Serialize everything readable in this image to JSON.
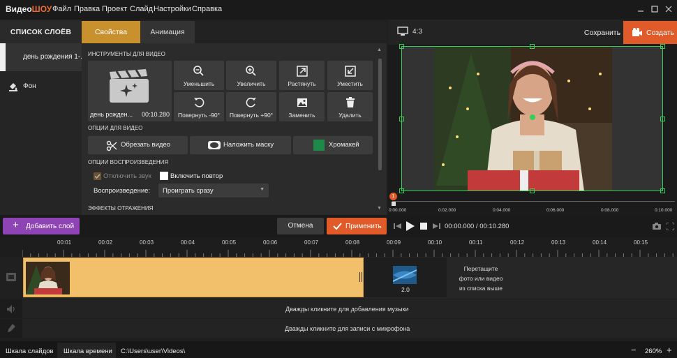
{
  "app": {
    "logo_part1": "Видео",
    "logo_part2": "ШОУ"
  },
  "menu": [
    "Файл",
    "Правка",
    "Проект",
    "Слайд",
    "Настройки",
    "Справка"
  ],
  "left": {
    "header": "СПИСОК СЛОЁВ",
    "layers": [
      {
        "label": "день рождения 1-..."
      },
      {
        "label": "Фон"
      }
    ]
  },
  "tabs": {
    "properties": "Свойства",
    "animation": "Анимация"
  },
  "props": {
    "section_tools": "ИНСТРУМЕНТЫ ДЛЯ ВИДЕО",
    "clip_name": "день рожден...",
    "clip_duration": "00:10.280",
    "tools": [
      {
        "label": "Уменьшить",
        "icon": "zoom-out-icon"
      },
      {
        "label": "Увеличить",
        "icon": "zoom-in-icon"
      },
      {
        "label": "Растянуть",
        "icon": "stretch-icon"
      },
      {
        "label": "Уместить",
        "icon": "fit-icon"
      },
      {
        "label": "Повернуть -90°",
        "icon": "rotate-left-icon"
      },
      {
        "label": "Повернуть +90°",
        "icon": "rotate-right-icon"
      },
      {
        "label": "Заменить",
        "icon": "replace-icon"
      },
      {
        "label": "Удалить",
        "icon": "delete-icon"
      }
    ],
    "section_video_options": "ОПЦИИ ДЛЯ ВИДЕО",
    "btn_trim": "Обрезать видео",
    "btn_mask": "Наложить маску",
    "btn_chroma": "Хромакей",
    "chroma_color": "#1e8a4a",
    "section_playback": "ОПЦИИ ВОСПРОИЗВЕДЕНИЯ",
    "mute_label": "Отключить звук",
    "mute_checked": true,
    "loop_label": "Включить повтор",
    "loop_checked": false,
    "playback_label": "Воспроизведение:",
    "playback_value": "Проиграть сразу",
    "section_reflection": "ЭФФЕКТЫ ОТРАЖЕНИЯ"
  },
  "preview": {
    "aspect": "4:3",
    "save": "Сохранить",
    "create": "Создать",
    "accent": "#e05a2a",
    "frame_color": "#33d15a",
    "marker": "1",
    "ticks": [
      "0:00.000",
      "0:02.000",
      "0:04.000",
      "0:06.000",
      "0:08.000",
      "0:10.000"
    ]
  },
  "actions": {
    "add_layer": "Добавить слой",
    "cancel": "Отмена",
    "apply": "Применить",
    "time_current": "00:00.000",
    "time_separator": " / ",
    "time_total": "00:10.280"
  },
  "timeline": {
    "ruler": [
      "00:01",
      "00:02",
      "00:03",
      "00:04",
      "00:05",
      "00:06",
      "00:07",
      "00:08",
      "00:09",
      "00:10",
      "00:11",
      "00:12",
      "00:13",
      "00:14",
      "00:15"
    ],
    "transition_duration": "2.0",
    "drop_hint_1": "Перетащите",
    "drop_hint_2": "фото или видео",
    "drop_hint_3": "из списка выше",
    "music_hint": "Дважды кликните для добавления музыки",
    "mic_hint": "Дважды кликните для записи с микрофона",
    "clip_color": "#f2c06b"
  },
  "status": {
    "tab_slides": "Шкала слайдов",
    "tab_timeline": "Шкала времени",
    "path": "C:\\Users\\user\\Videos\\",
    "zoom": "260%"
  }
}
